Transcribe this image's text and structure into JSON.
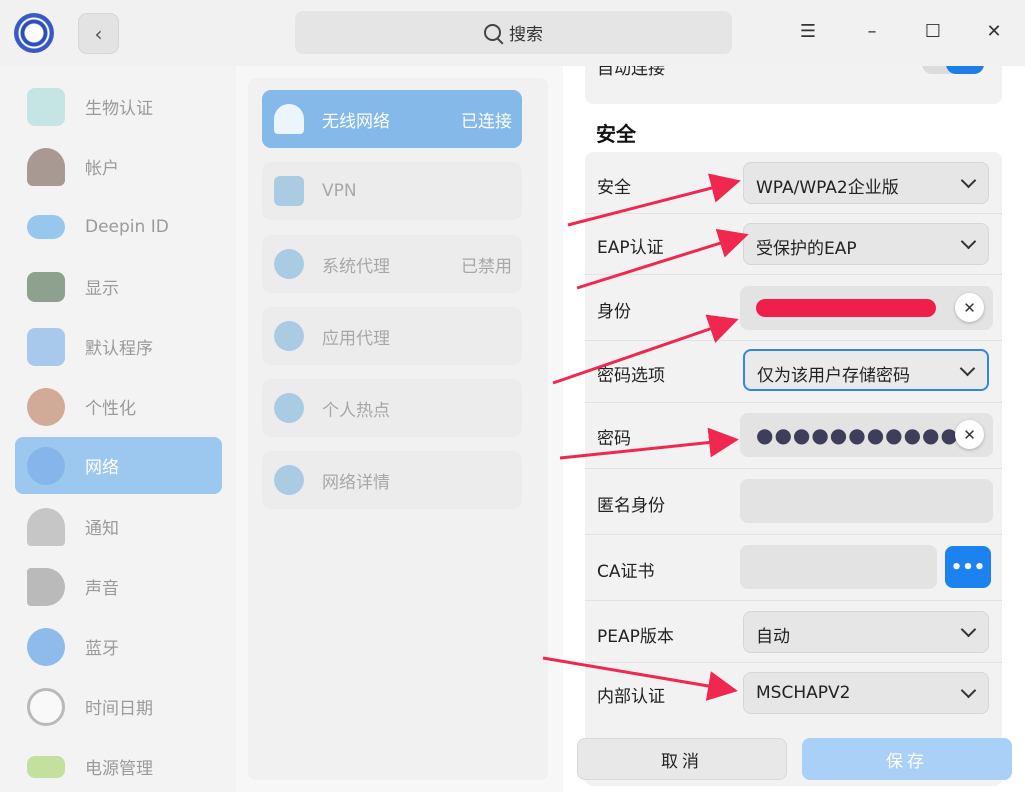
{
  "search": {
    "label": "搜索"
  },
  "sidebar": {
    "items": [
      {
        "label": "生物认证",
        "icon": "fingerprint-icon",
        "color": "#9fd8d8"
      },
      {
        "label": "帐户",
        "icon": "user-icon",
        "color": "#6a4f44"
      },
      {
        "label": "Deepin ID",
        "icon": "cloud-icon",
        "color": "#4aa3e8"
      },
      {
        "label": "显示",
        "icon": "monitor-icon",
        "color": "#3b5b3b"
      },
      {
        "label": "默认程序",
        "icon": "default-apps-icon",
        "color": "#6aa6e6"
      },
      {
        "label": "个性化",
        "icon": "palette-icon",
        "color": "#b6704c"
      },
      {
        "label": "网络",
        "icon": "network-icon",
        "color": "#7fb0e8",
        "active": true
      },
      {
        "label": "通知",
        "icon": "bell-icon",
        "color": "#a0a0a0"
      },
      {
        "label": "声音",
        "icon": "speaker-icon",
        "color": "#8a8a8a"
      },
      {
        "label": "蓝牙",
        "icon": "bluetooth-icon",
        "color": "#3b8de0"
      },
      {
        "label": "时间日期",
        "icon": "clock-icon",
        "color": "#d8d8d8"
      },
      {
        "label": "电源管理",
        "icon": "battery-icon",
        "color": "#9bcf5a"
      }
    ]
  },
  "middle": {
    "items": [
      {
        "label": "无线网络",
        "status": "已连接",
        "icon": "wifi-icon",
        "active": true
      },
      {
        "label": "VPN",
        "status": "",
        "icon": "vpn-icon"
      },
      {
        "label": "系统代理",
        "status": "已禁用",
        "icon": "system-proxy-icon"
      },
      {
        "label": "应用代理",
        "status": "",
        "icon": "app-proxy-icon"
      },
      {
        "label": "个人热点",
        "status": "",
        "icon": "hotspot-icon"
      },
      {
        "label": "网络详情",
        "status": "",
        "icon": "info-icon"
      }
    ]
  },
  "settings": {
    "partial_label": "自动连接",
    "section_title": "安全",
    "security": {
      "label": "安全",
      "value": "WPA/WPA2企业版"
    },
    "eap": {
      "label": "EAP认证",
      "value": "受保护的EAP"
    },
    "identity": {
      "label": "身份"
    },
    "pwd_option": {
      "label": "密码选项",
      "value": "仅为该用户存储密码"
    },
    "password": {
      "label": "密码",
      "value": "●●●●●●●●●●●"
    },
    "anon_identity": {
      "label": "匿名身份",
      "value": ""
    },
    "ca_cert": {
      "label": "CA证书",
      "value": "",
      "button": "•••"
    },
    "peap_version": {
      "label": "PEAP版本",
      "value": "自动"
    },
    "inner_auth": {
      "label": "内部认证",
      "value": "MSCHAPV2"
    }
  },
  "buttons": {
    "cancel": "取消",
    "save": "保存"
  },
  "colors": {
    "accent": "#1b82f0",
    "annotation_arrow": "#f0274f",
    "redaction": "#f01f4a"
  }
}
